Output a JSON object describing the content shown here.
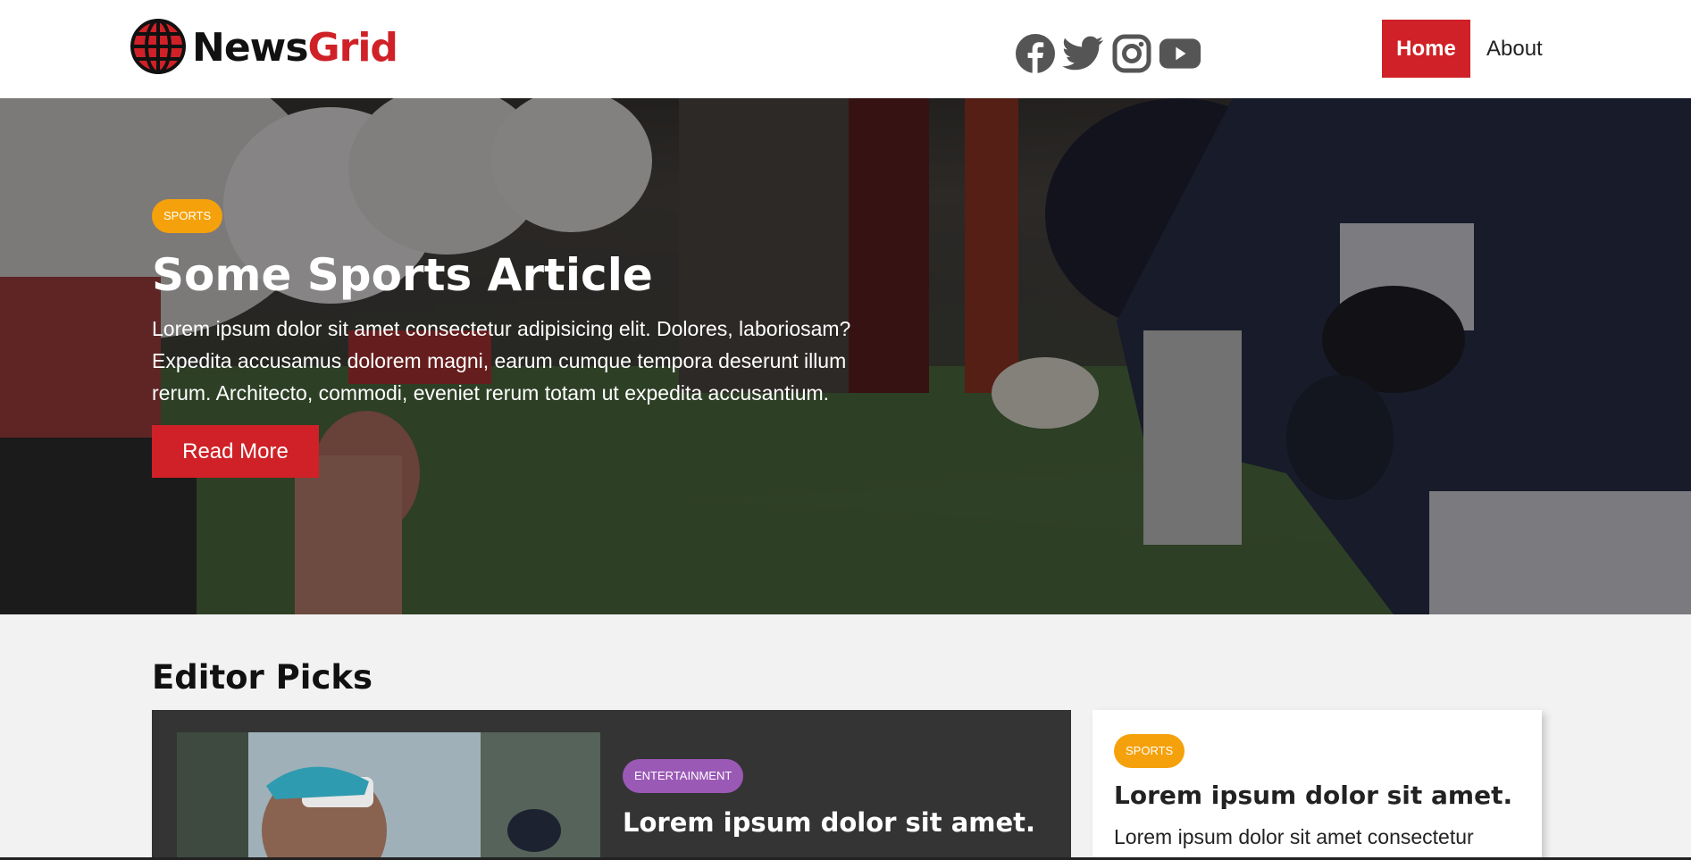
{
  "header": {
    "logo": {
      "part1": "News",
      "part2": "Grid"
    },
    "social": [
      "facebook-icon",
      "twitter-icon",
      "instagram-icon",
      "youtube-icon"
    ],
    "nav": {
      "home": "Home",
      "about": "About"
    }
  },
  "hero": {
    "badge": "SPORTS",
    "title": "Some Sports Article",
    "description": "Lorem ipsum dolor sit amet consectetur adipisicing elit. Dolores, laboriosam? Expedita accusamus dolorem magni, earum cumque tempora deserunt illum rerum. Architecto, commodi, eveniet rerum totam ut expedita accusantium.",
    "button": "Read More"
  },
  "editor_picks": {
    "title": "Editor Picks",
    "featured": {
      "badge": "ENTERTAINMENT",
      "title": "Lorem ipsum dolor sit amet."
    },
    "side": {
      "badge": "SPORTS",
      "title": "Lorem ipsum dolor sit amet.",
      "description": "Lorem ipsum dolor sit amet consectetur"
    }
  },
  "colors": {
    "brand_red": "#cf2127",
    "sports_badge": "#f5a10b",
    "entertainment_badge": "#9b59b6",
    "dark_card": "#343434"
  }
}
